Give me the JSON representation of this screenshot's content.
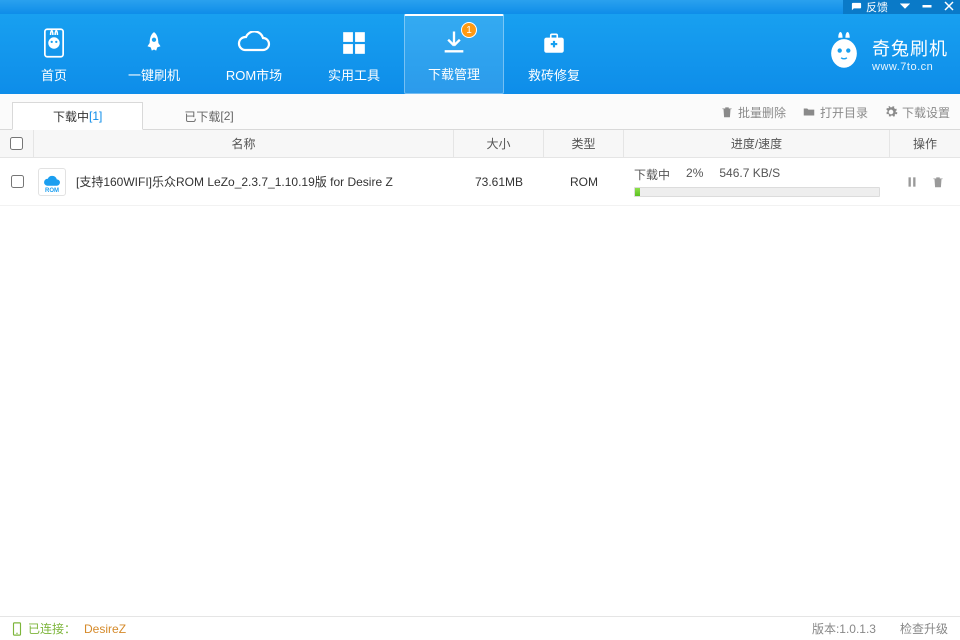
{
  "titlebar": {
    "feedback": "反馈"
  },
  "nav": {
    "home": "首页",
    "flash": "一键刷机",
    "market": "ROM市场",
    "tools": "实用工具",
    "download": "下载管理",
    "rescue": "救砖修复",
    "badge": "1"
  },
  "brand": {
    "name": "奇兔刷机",
    "url": "www.7to.cn"
  },
  "tabs": {
    "downloading": "下载中",
    "downloading_count": "[1]",
    "downloaded": "已下载",
    "downloaded_count": "[2]"
  },
  "actions": {
    "batch_delete": "批量删除",
    "open_dir": "打开目录",
    "settings": "下载设置"
  },
  "columns": {
    "name": "名称",
    "size": "大小",
    "type": "类型",
    "progress": "进度/速度",
    "op": "操作"
  },
  "rows": [
    {
      "name": "[支持160WIFI]乐众ROM LeZo_2.3.7_1.10.19版 for Desire Z",
      "size": "73.61MB",
      "type": "ROM",
      "status": "下载中",
      "percent": "2%",
      "speed": "546.7 KB/S",
      "progress_width": "2%"
    }
  ],
  "status": {
    "connected": "已连接：",
    "device": "DesireZ",
    "version_label": "版本:",
    "version": "1.0.1.3",
    "check_update": "检查升级"
  }
}
